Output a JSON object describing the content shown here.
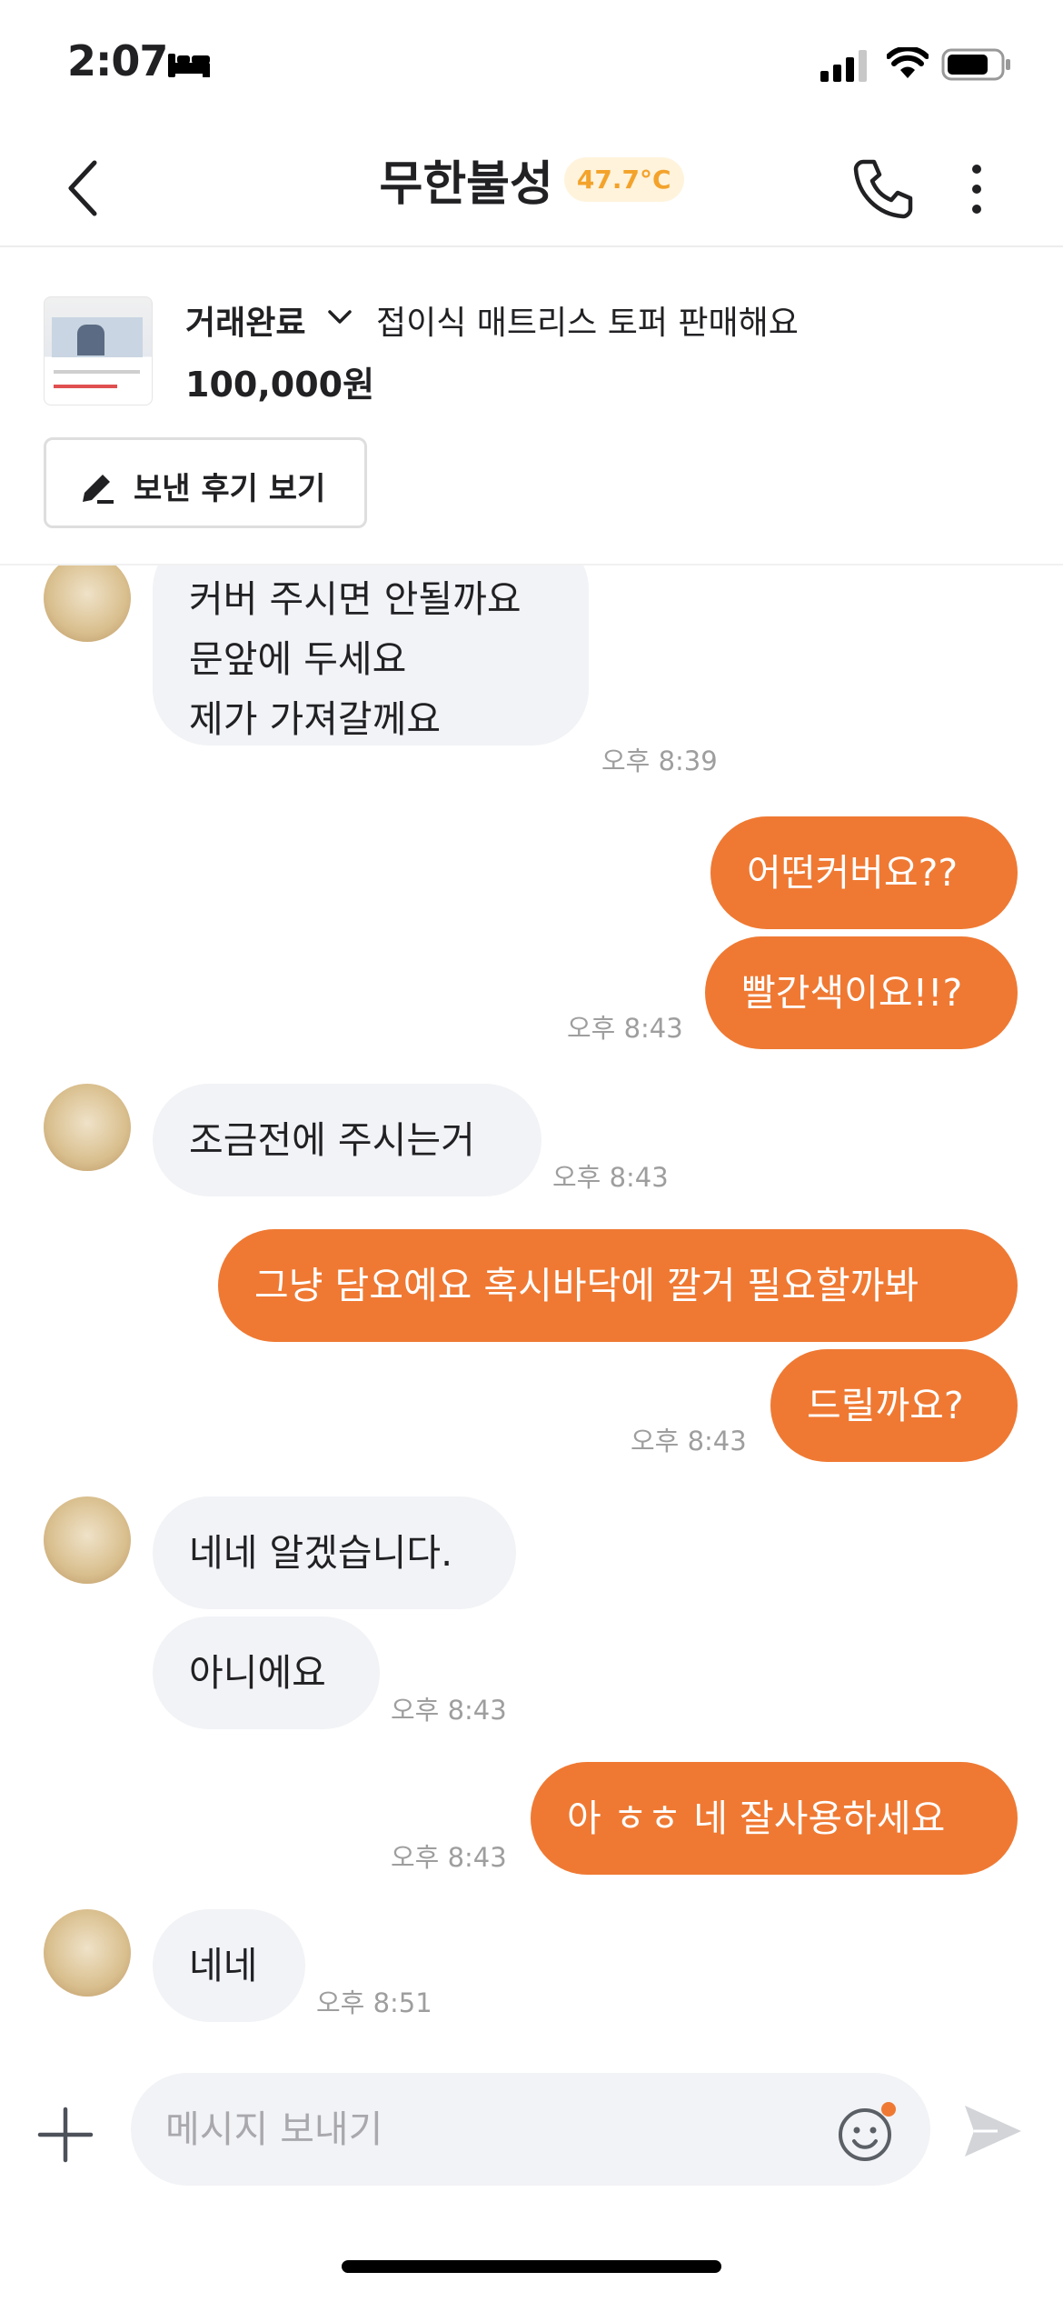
{
  "status_bar": {
    "time": "2:07"
  },
  "header": {
    "title": "무한불성",
    "temperature": "47.7°C"
  },
  "product": {
    "status": "거래완료",
    "title": "접이식 매트리스 토퍼 판매해요",
    "price": "100,000원",
    "review_button": "보낸 후기 보기"
  },
  "messages": {
    "m1": {
      "lines": [
        "커버 주시면 안될까요",
        "문앞에 두세요",
        "제가 가져갈께요"
      ],
      "time": "오후 8:39"
    },
    "m2": {
      "text": "어떤커버요??"
    },
    "m3": {
      "text": "빨간색이요!!?",
      "time": "오후 8:43"
    },
    "m4": {
      "text": "조금전에 주시는거",
      "time": "오후 8:43"
    },
    "m5": {
      "text": "그냥 담요예요 혹시바닥에 깔거 필요할까봐"
    },
    "m6": {
      "text": "드릴까요?",
      "time": "오후 8:43"
    },
    "m7": {
      "text": "네네 알겠습니다."
    },
    "m8": {
      "text": "아니에요",
      "time": "오후 8:43"
    },
    "m9": {
      "text": "아 ㅎㅎ 네 잘사용하세요",
      "time": "오후 8:43"
    },
    "m10": {
      "text": "네네",
      "time": "오후 8:51"
    }
  },
  "input": {
    "placeholder": "메시지 보내기"
  },
  "colors": {
    "accent": "#ef7933",
    "incoming_bubble": "#f2f3f6",
    "temperature": "#f3a32b"
  },
  "icons": [
    "bed-icon",
    "signal-icon",
    "wifi-icon",
    "battery-icon",
    "back-icon",
    "phone-icon",
    "more-icon",
    "chevron-down-icon",
    "pencil-icon",
    "plus-icon",
    "emoji-icon",
    "send-icon"
  ]
}
